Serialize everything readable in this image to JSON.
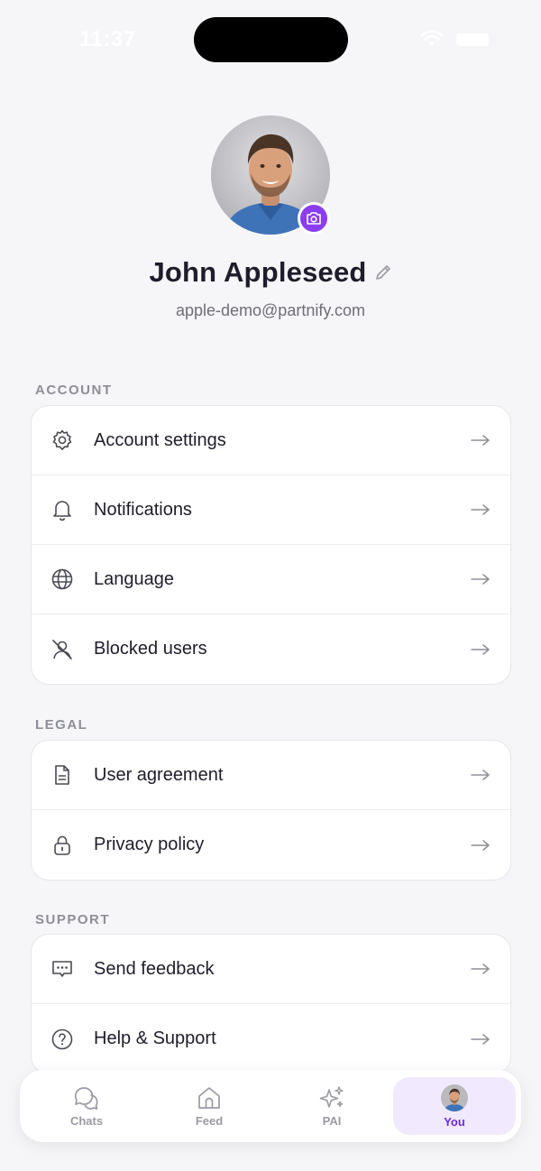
{
  "status_bar": {
    "time": "11:37"
  },
  "profile": {
    "name": "John Appleseed",
    "email": "apple-demo@partnify.com"
  },
  "sections": {
    "account": {
      "label": "ACCOUNT",
      "items": [
        {
          "label": "Account settings",
          "icon": "gear-icon"
        },
        {
          "label": "Notifications",
          "icon": "bell-icon"
        },
        {
          "label": "Language",
          "icon": "globe-icon"
        },
        {
          "label": "Blocked users",
          "icon": "user-blocked-icon"
        }
      ]
    },
    "legal": {
      "label": "LEGAL",
      "items": [
        {
          "label": "User agreement",
          "icon": "document-icon"
        },
        {
          "label": "Privacy policy",
          "icon": "lock-icon"
        }
      ]
    },
    "support": {
      "label": "SUPPORT",
      "items": [
        {
          "label": "Send feedback",
          "icon": "feedback-icon"
        },
        {
          "label": "Help & Support",
          "icon": "help-icon"
        }
      ]
    }
  },
  "tab_bar": {
    "tabs": [
      {
        "label": "Chats",
        "icon": "chat-bubbles-icon"
      },
      {
        "label": "Feed",
        "icon": "home-icon"
      },
      {
        "label": "PAI",
        "icon": "sparkles-icon"
      },
      {
        "label": "You",
        "icon": "avatar-icon",
        "active": true
      }
    ]
  },
  "colors": {
    "accent": "#8b3df0",
    "active_tab_bg": "#f1eafe",
    "active_tab_text": "#6b2fd6",
    "background": "#f6f6f9"
  }
}
